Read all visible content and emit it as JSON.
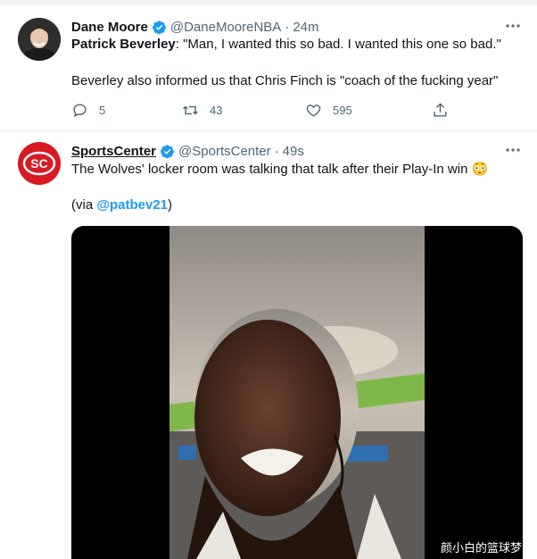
{
  "tweets": [
    {
      "name": "Dane Moore",
      "handle": "@DaneMooreNBA",
      "time": "24m",
      "text_bold": "Patrick Beverley",
      "text_rest": ": \"Man, I wanted this so bad. I wanted this one so bad.\"",
      "text_line2": "Beverley also informed us that Chris Finch is \"coach of the fucking year\"",
      "replies": "5",
      "retweets": "43",
      "likes": "595"
    },
    {
      "name": "SportsCenter",
      "handle": "@SportsCenter",
      "time": "49s",
      "text_line1": "The Wolves' locker room was talking that talk after their Play-In win 😳",
      "via_prefix": "(via ",
      "via_handle": "@patbev21",
      "via_suffix": ")"
    }
  ],
  "separator": "·",
  "watermark": "颜小白的篮球梦",
  "colors": {
    "verified_blue": "#1d9bf0",
    "link": "#1d9bf0",
    "espn_red": "#d71920",
    "muted_text": "#536471"
  },
  "icons": [
    "verified-badge-icon",
    "more-icon",
    "reply-icon",
    "retweet-icon",
    "like-icon",
    "share-icon"
  ]
}
